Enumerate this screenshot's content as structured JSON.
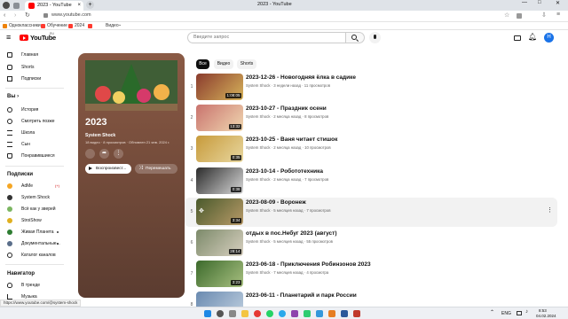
{
  "browser": {
    "tab_title": "2023 - YouTube",
    "url": "www.youtube.com",
    "window_title": "2023 - YouTube",
    "bookmarks": [
      "Одноклассники",
      "Обучение",
      "2024",
      "Видео"
    ]
  },
  "header": {
    "logo_text": "YouTube",
    "logo_region": "RU",
    "search_placeholder": "Введите запрос",
    "avatar_letter": "Н"
  },
  "sidebar": {
    "main": [
      "Главная",
      "Shorts",
      "Подписки"
    ],
    "you_heading": "Вы",
    "you_items": [
      "История",
      "Смотреть позже",
      "Школа",
      "Сын",
      "Понравившиеся"
    ],
    "subs_heading": "Подписки",
    "subs": [
      "AdMe",
      "System Shock",
      "Всё как у зверей",
      "StroiShow",
      "Живая Планета",
      "Документальные...",
      "Каталог каналов"
    ],
    "adme_badge": "(+)",
    "nav_heading": "Навигатор",
    "nav_items": [
      "В тренде",
      "Музыка"
    ]
  },
  "playlist": {
    "title": "2023",
    "channel": "System Shock",
    "stats": "18 видео · 8 просмотров · Обновлен 21 янв. 2024 г.",
    "play_label": "Воспроизвест...",
    "shuffle_label": "Перемешать"
  },
  "chips": [
    "Все",
    "Видео",
    "Shorts"
  ],
  "videos": [
    {
      "n": "1",
      "title": "2023-12-26 - Новогодняя ёлка в садике",
      "meta": "System Shock · 3 недели назад · 11 просмотров",
      "dur": "1:08:05",
      "c1": "#8a3b2e",
      "c2": "#d6b35a"
    },
    {
      "n": "2",
      "title": "2023-10-27 - Праздник осени",
      "meta": "System Shock · 2 месяца назад · 8 просмотров",
      "dur": "13:32",
      "c1": "#c9736e",
      "c2": "#f0d7b0"
    },
    {
      "n": "3",
      "title": "2023-10-25 - Ваня читает стишок",
      "meta": "System Shock · 2 месяца назад · 10 просмотров",
      "dur": "0:35",
      "c1": "#c79a3a",
      "c2": "#e8d7a0"
    },
    {
      "n": "4",
      "title": "2023-10-14 - Робототехника",
      "meta": "System Shock · 2 месяца назад · 7 просмотров",
      "dur": "0:38",
      "c1": "#2b2b2b",
      "c2": "#d9d9d9"
    },
    {
      "n": "5",
      "title": "2023-08-09 - Воронеж",
      "meta": "System Shock · 5 месяцев назад · 7 просмотров",
      "dur": "3:34",
      "c1": "#4a5a2c",
      "c2": "#b89a68"
    },
    {
      "n": "6",
      "title": "отдых в пос.Небуг 2023 (август)",
      "meta": "System Shock · 5 месяцев назад · 55 просмотров",
      "dur": "28:14",
      "c1": "#7c8a6a",
      "c2": "#d8d0c0"
    },
    {
      "n": "7",
      "title": "2023-06-18 - Приключения Робинзонов 2023",
      "meta": "System Shock · 7 месяцев назад · 4 просмотра",
      "dur": "3:23",
      "c1": "#3c6a2c",
      "c2": "#a8c080"
    },
    {
      "n": "8",
      "title": "2023-06-11 - Планетарий и парк России",
      "meta": "",
      "dur": "",
      "c1": "#6a8ab0",
      "c2": "#c0d0e0"
    }
  ],
  "status_url": "https://www.youtube.com/@system-shock",
  "taskbar": {
    "lang": "ENG",
    "time": "8:53",
    "date": "04.02.2024"
  },
  "colors": {
    "yt_red": "#ff0000",
    "card_brown": "#7a4f3e",
    "accent_blue": "#1a73e8"
  }
}
